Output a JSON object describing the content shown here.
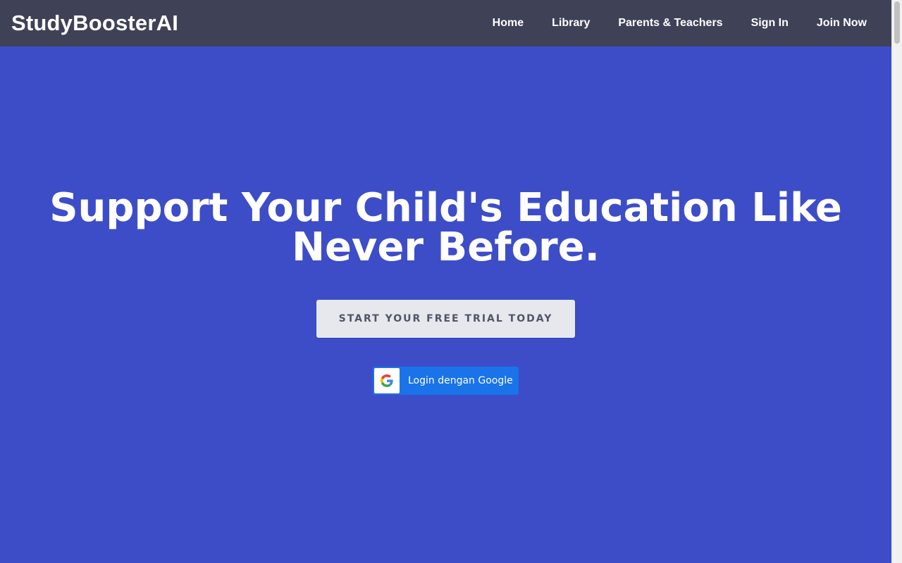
{
  "navbar": {
    "brand": "StudyBoosterAI",
    "links": [
      {
        "label": "Home"
      },
      {
        "label": "Library"
      },
      {
        "label": "Parents & Teachers"
      },
      {
        "label": "Sign In"
      },
      {
        "label": "Join Now"
      }
    ]
  },
  "hero": {
    "headline_line1": "Support Your Child's Education Like",
    "headline_line2": "Never Before.",
    "cta_label": "START YOUR FREE TRIAL TODAY",
    "google_login_label": "Login dengan Google",
    "google_icon": "google-g-icon"
  },
  "colors": {
    "navbar_bg": "#3f4157",
    "hero_bg": "#3d4dc8",
    "cta_bg": "#e6e8ee",
    "google_button_bg": "#1a73e8"
  }
}
